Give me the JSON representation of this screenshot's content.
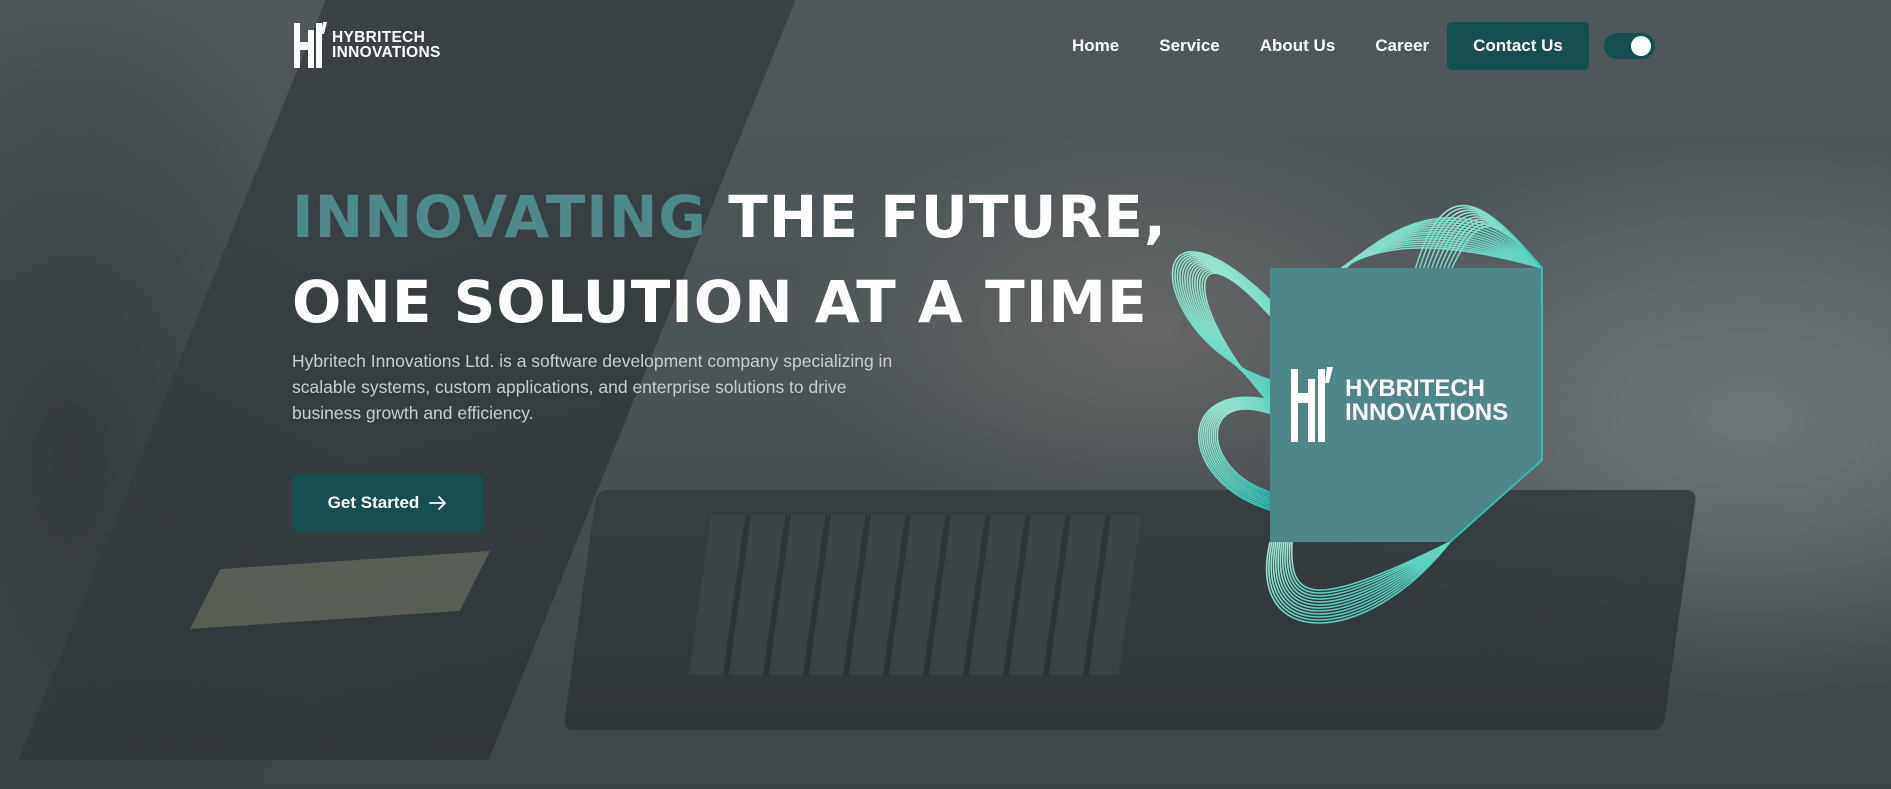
{
  "brand": {
    "name_line1": "HYBRITECH",
    "name_line2": "INNOVATIONS"
  },
  "nav": {
    "links": [
      {
        "label": "Home"
      },
      {
        "label": "Service"
      },
      {
        "label": "About Us"
      },
      {
        "label": "Career"
      }
    ],
    "contact_label": "Contact Us",
    "theme_toggle": {
      "state": "on"
    }
  },
  "hero": {
    "title_accent": "INNOVATING",
    "title_rest_line1": " THE FUTURE,",
    "title_line2": "ONE SOLUTION AT A TIME",
    "description": "Hybritech Innovations Ltd. is a software development company specializing in scalable systems, custom applications, and enterprise solutions to drive business growth and efficiency.",
    "cta_label": "Get Started",
    "cta_icon": "arrow-right-icon"
  },
  "graphic": {
    "brand_line1": "HYBRITECH",
    "brand_line2": "INNOVATIONS"
  },
  "colors": {
    "accent": "#4f8a8a",
    "button_bg": "#154f4f",
    "panel": "#4e8787",
    "wave_light": "#9fe6cf",
    "wave_teal": "#2fc1b4"
  }
}
